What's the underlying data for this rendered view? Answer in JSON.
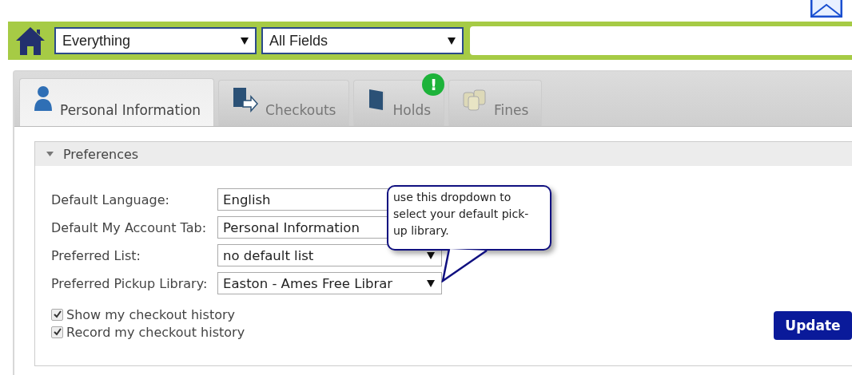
{
  "search_bar": {
    "scope": {
      "value": "Everything"
    },
    "field": {
      "value": "All Fields"
    }
  },
  "tabs": [
    {
      "label": "Personal Information",
      "selected": true
    },
    {
      "label": "Checkouts",
      "selected": false
    },
    {
      "label": "Holds",
      "selected": false,
      "badge": "!"
    },
    {
      "label": "Fines",
      "selected": false
    }
  ],
  "preferences": {
    "title": "Preferences",
    "expanded": true,
    "fields": [
      {
        "label": "Default Language:",
        "value": "English",
        "caret_visible": false
      },
      {
        "label": "Default My Account Tab:",
        "value": "Personal Information",
        "caret_visible": false
      },
      {
        "label": "Preferred List:",
        "value": "no default list",
        "caret_visible": true
      },
      {
        "label": "Preferred Pickup Library:",
        "value": "Easton - Ames Free Librar",
        "caret_visible": true
      }
    ],
    "checkboxes": [
      {
        "label": "Show my checkout history",
        "checked": true
      },
      {
        "label": "Record my checkout history",
        "checked": true
      }
    ],
    "button": "Update"
  },
  "callout": {
    "text": "use this dropdown to select your default pick-up library."
  }
}
